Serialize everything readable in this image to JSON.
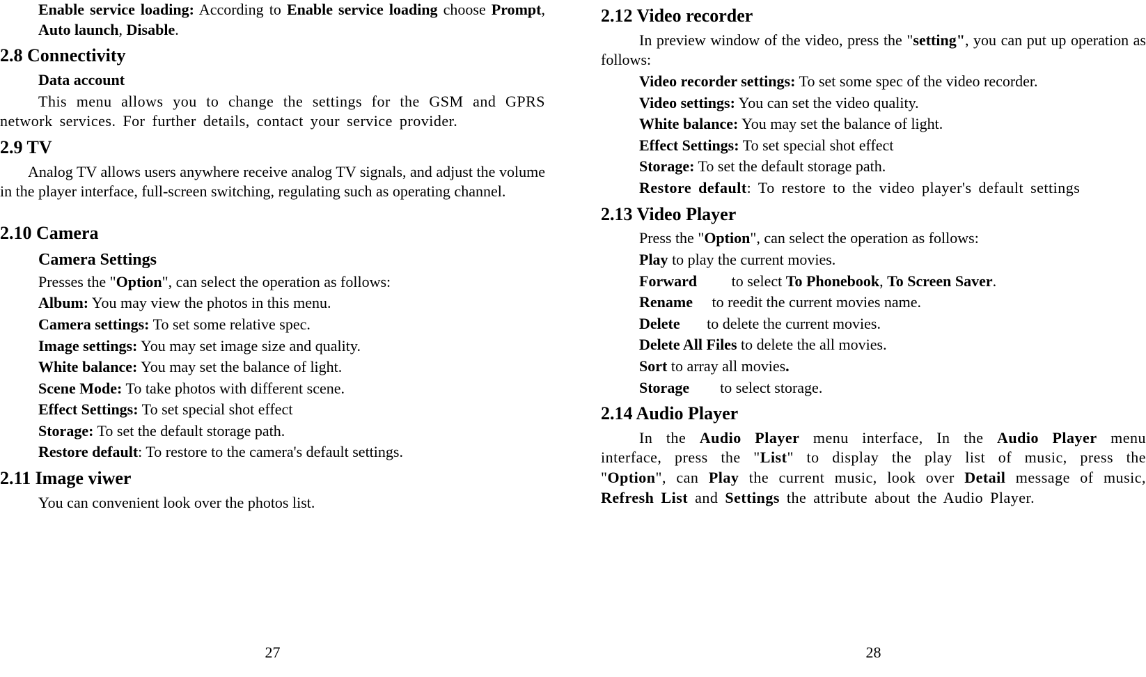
{
  "left": {
    "service_loading_line_html": "Enable service loading: According to Enable service loading choose Prompt, Auto launch, Disable.",
    "service_loading_prefix_b": "Enable service loading:",
    "service_loading_mid": " According to ",
    "service_loading_b2": "Enable service loading",
    "service_loading_mid2": " choose ",
    "service_loading_b3": "Prompt",
    "service_loading_c1": ", ",
    "service_loading_b4": "Auto launch",
    "service_loading_c2": ", ",
    "service_loading_b5": "Disable",
    "service_loading_end": ".",
    "h28": "2.8 Connectivity",
    "data_account_head": "Data account",
    "data_account_body": "This menu allows you to change the settings for the GSM and GPRS network services. For further details, contact your service provider.",
    "h29": "2.9 TV",
    "tv_body": "Analog TV allows users anywhere receive analog TV signals, and adjust the volume in the player interface, full-screen switching, regulating such as operating channel.",
    "h210": "2.10 Camera",
    "camera_settings_head": "Camera Settings",
    "cam_intro_pre": "Presses the \"",
    "cam_intro_b": "Option",
    "cam_intro_post": "\", can select the operation as follows:",
    "album_b": "Album:",
    "album_t": " You may view the photos in this menu.",
    "camset_b": "Camera settings:",
    "camset_t": " To set some relative spec.",
    "imgset_b": "Image settings:",
    "imgset_t": " You may set image size and quality.",
    "wb_b": "White balance:",
    "wb_t": " You may set the balance of light.",
    "scene_b": "Scene Mode:",
    "scene_t": " To take photos with different scene.",
    "effect_b": "Effect Settings:",
    "effect_t": " To set special shot effect",
    "storage_b": "Storage:",
    "storage_t": " To set the default storage path.",
    "restore_b": "Restore default",
    "restore_t": ": To restore to the camera's default settings.",
    "h211": "2.11 Image viwer",
    "imgviewer_body": "You can convenient look over the photos list.",
    "page_num": "27"
  },
  "right": {
    "h212": "2.12 Video recorder",
    "vrec_intro_pre": "In preview window of the video, press the \"",
    "vrec_intro_b": "setting\"",
    "vrec_intro_post": ", you can put up operation as follows:",
    "vrec_set_b": "Video recorder settings:",
    "vrec_set_t": " To set some spec of the video recorder.",
    "vset_b": "Video settings:",
    "vset_t": " You can set the video quality.",
    "vwb_b": "White balance:",
    "vwb_t": " You may set the balance of light.",
    "veff_b": "Effect Settings:",
    "veff_t": " To set special shot effect",
    "vstor_b": "Storage:",
    "vstor_t": " To set the default storage path.",
    "vrestore_b": "Restore default",
    "vrestore_t": ": To restore to the video player's default settings",
    "h213": "2.13 Video Player",
    "vp_intro_pre": "Press the \"",
    "vp_intro_b": "Option",
    "vp_intro_post": "\", can select the operation as follows:",
    "play_b": "Play",
    "play_t": "  to play the current movies.",
    "fwd_b": "Forward",
    "fwd_t_pre": "         to select ",
    "fwd_t_b1": "To Phonebook",
    "fwd_t_mid": ", ",
    "fwd_t_b2": "To Screen Saver",
    "fwd_t_end": ".",
    "rename_b": "Rename",
    "rename_t": "     to reedit the current movies name.",
    "delete_b": "Delete",
    "delete_t": "       to delete the current movies.",
    "delall_b": "Delete All Files",
    "delall_t": " to delete the all movies.",
    "sort_b": "Sort",
    "sort_t": "  to array all movies",
    "sort_dot": ".",
    "vstorage_b": "Storage",
    "vstorage_t": "        to select storage.",
    "h214": "2.14 Audio Player",
    "ap_pre1": "In the ",
    "ap_b1": "Audio Player",
    "ap_mid1": " menu interface, In the ",
    "ap_b2": "Audio Player",
    "ap_mid2": " menu interface, press the \"",
    "ap_b3": "List",
    "ap_mid3": "\" to display the play list of music, press the \"",
    "ap_b4": "Option",
    "ap_mid4": "\", can ",
    "ap_b5": "Play",
    "ap_mid5": " the current music, look over ",
    "ap_b6": "Detail",
    "ap_mid6": " message of music, ",
    "ap_b7": "Refresh List",
    "ap_mid7": " and ",
    "ap_b8": "Settings",
    "ap_end": " the attribute about the Audio Player.",
    "page_num": "28"
  }
}
